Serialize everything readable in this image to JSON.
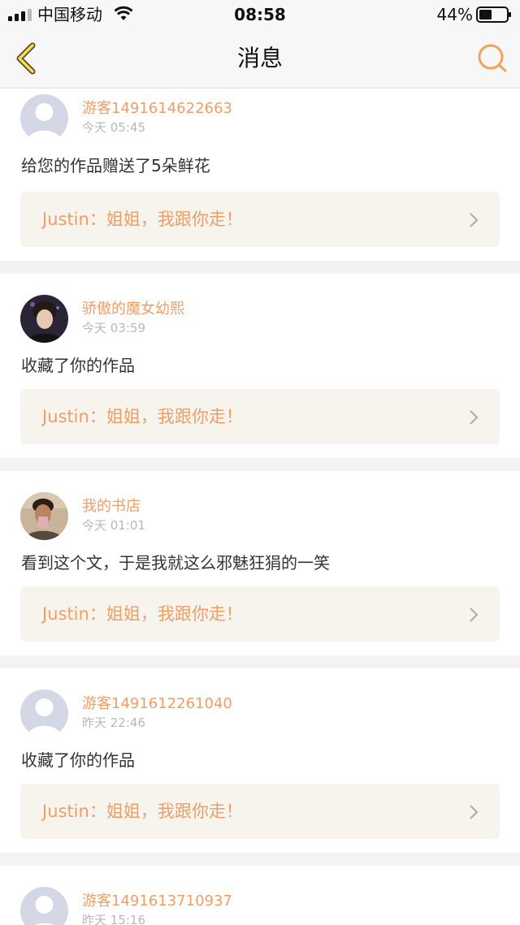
{
  "status_bar": {
    "carrier": "中国移动",
    "time": "08:58",
    "battery": "44%"
  },
  "nav": {
    "title": "消息",
    "accent_color": "#f0a35e"
  },
  "messages": [
    {
      "username": "游客1491614622663",
      "time": "今天 05:45",
      "content": "给您的作品赠送了5朵鲜花",
      "quote": "Justin：姐姐，我跟你走！",
      "avatar": "default-avatar"
    },
    {
      "username": "骄傲的魔女幼熙",
      "time": "今天 03:59",
      "content": "收藏了你的作品",
      "quote": "Justin：姐姐，我跟你走！",
      "avatar": "photo-avatar"
    },
    {
      "username": "我的书店",
      "time": "今天 01:01",
      "content": "看到这个文，于是我就这么邪魅狂狷的一笑",
      "quote": "Justin：姐姐，我跟你走！",
      "avatar": "photo-avatar"
    },
    {
      "username": "游客1491612261040",
      "time": "昨天 22:46",
      "content": "收藏了你的作品",
      "quote": "Justin：姐姐，我跟你走！",
      "avatar": "default-avatar"
    },
    {
      "username": "游客1491613710937",
      "time": "昨天 15:16",
      "content": "",
      "quote": "",
      "avatar": "default-avatar"
    }
  ]
}
